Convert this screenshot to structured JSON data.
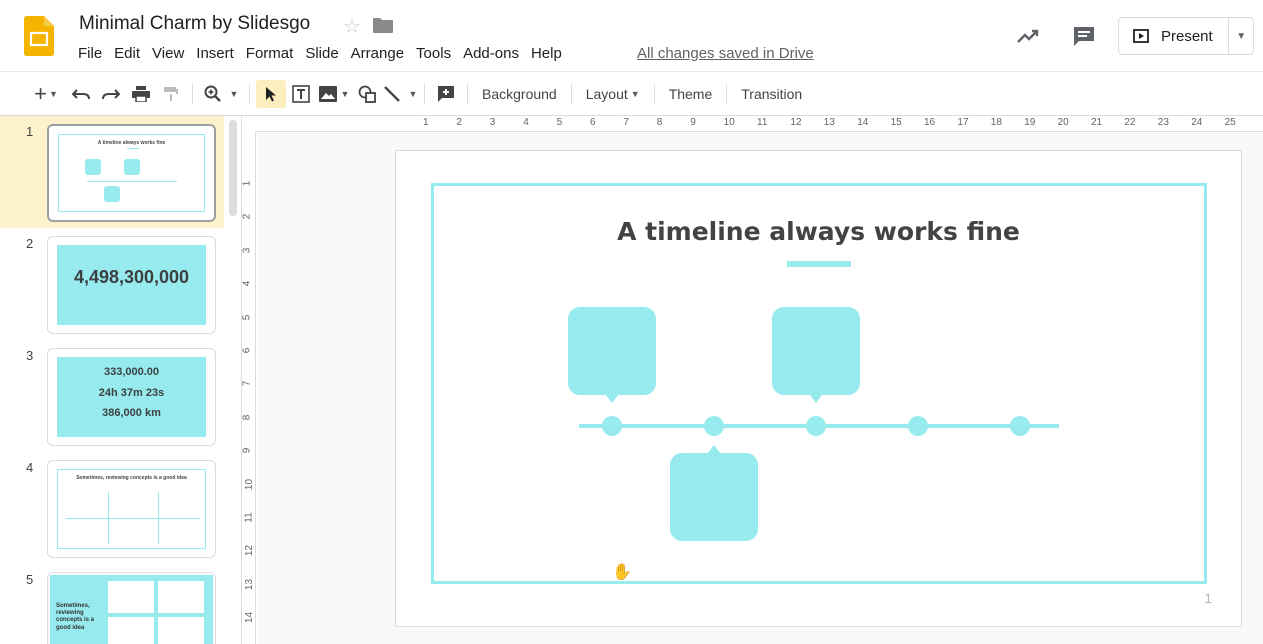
{
  "header": {
    "title": "Minimal Charm by Slidesgo",
    "menu": [
      "File",
      "Edit",
      "View",
      "Insert",
      "Format",
      "Slide",
      "Arrange",
      "Tools",
      "Add-ons",
      "Help"
    ],
    "saved_status": "All changes saved in Drive",
    "present_label": "Present"
  },
  "toolbar": {
    "background_label": "Background",
    "layout_label": "Layout",
    "theme_label": "Theme",
    "transition_label": "Transition"
  },
  "rulers": {
    "top": [
      "1",
      "2",
      "3",
      "4",
      "5",
      "6",
      "7",
      "8",
      "9",
      "10",
      "11",
      "12",
      "13",
      "14",
      "15",
      "16",
      "17",
      "18",
      "19",
      "20",
      "21",
      "22",
      "23",
      "24",
      "25"
    ],
    "left": [
      "1",
      "2",
      "3",
      "4",
      "5",
      "6",
      "7",
      "8",
      "9",
      "10",
      "11",
      "12",
      "13",
      "14"
    ]
  },
  "slides": [
    {
      "number": "1",
      "title": "A timeline always works fine"
    },
    {
      "number": "2",
      "big": "4,498,300,000"
    },
    {
      "number": "3",
      "lines": [
        "333,000.00",
        "24h 37m 23s",
        "386,000 km"
      ]
    },
    {
      "number": "4",
      "title": "Sometimes, reviewing concepts is a good idea"
    },
    {
      "number": "5",
      "title": "Sometimes, reviewing concepts is a good idea"
    }
  ],
  "canvas": {
    "title": "A timeline always works fine",
    "page_number": "1"
  },
  "colors": {
    "accent": "#97ebee",
    "title_text": "#434343",
    "active_slide_bg": "#fef2cc"
  }
}
